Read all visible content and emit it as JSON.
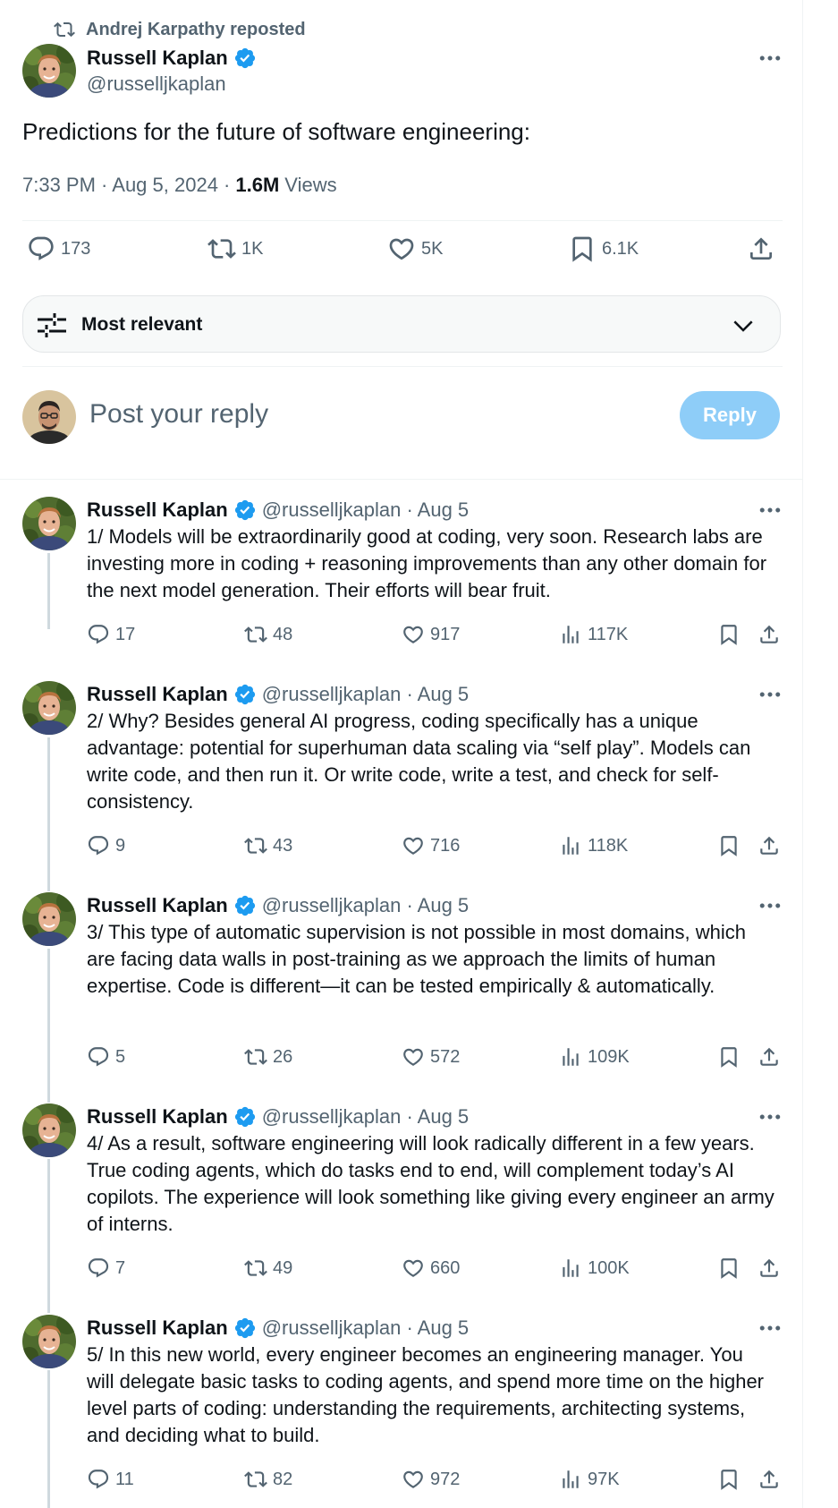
{
  "repost": {
    "text": "Andrej Karpathy reposted",
    "icon": "repost-icon"
  },
  "main_tweet": {
    "author": "Russell Kaplan",
    "handle": "@russelljkaplan",
    "text": "Predictions for the future of software engineering:",
    "time": "7:33 PM · Aug 5, 2024 ·",
    "views_count": "1.6M",
    "views_label": "Views",
    "stats": {
      "replies": "173",
      "reposts": "1K",
      "likes": "5K",
      "bookmarks": "6.1K"
    }
  },
  "sort": {
    "label": "Most relevant"
  },
  "compose": {
    "placeholder": "Post your reply",
    "button": "Reply"
  },
  "replies": [
    {
      "author": "Russell Kaplan",
      "handle": "@russelljkaplan · Aug 5",
      "text": "1/ Models will be extraordinarily good at coding, very soon. Research labs are investing more in coding + reasoning improvements than any other domain for the next model generation. Their efforts will bear fruit.",
      "replies": "17",
      "reposts": "48",
      "likes": "917",
      "views": "117K"
    },
    {
      "author": "Russell Kaplan",
      "handle": "@russelljkaplan · Aug 5",
      "text": "2/ Why? Besides general AI progress, coding specifically has a unique advantage: potential for superhuman data scaling via “self play”. Models can write code, and then run it. Or write code, write a test, and check for self-consistency.",
      "replies": "9",
      "reposts": "43",
      "likes": "716",
      "views": "118K"
    },
    {
      "author": "Russell Kaplan",
      "handle": "@russelljkaplan · Aug 5",
      "text": "3/ This type of automatic supervision is not possible in most domains, which are facing data walls in post-training as we approach the limits of human expertise. Code is different—it can be tested empirically & automatically.",
      "replies": "5",
      "reposts": "26",
      "likes": "572",
      "views": "109K"
    },
    {
      "author": "Russell Kaplan",
      "handle": "@russelljkaplan · Aug 5",
      "text": "4/ As a result, software engineering will look radically different in a few years. True coding agents, which do tasks end to end, will complement today’s AI copilots. The experience will look something like giving every engineer an army of interns.",
      "replies": "7",
      "reposts": "49",
      "likes": "660",
      "views": "100K"
    },
    {
      "author": "Russell Kaplan",
      "handle": "@russelljkaplan · Aug 5",
      "text": "5/ In this new world, every engineer becomes an engineering manager. You will delegate basic tasks to coding agents, and spend more time on the higher level parts of coding: understanding the requirements, architecting systems, and deciding what to build.",
      "replies": "11",
      "reposts": "82",
      "likes": "972",
      "views": "97K"
    }
  ],
  "colors": {
    "accent": "#1d9bf0",
    "reply_button": "#8ecdf8",
    "muted": "#536471",
    "text": "#0f1419"
  }
}
